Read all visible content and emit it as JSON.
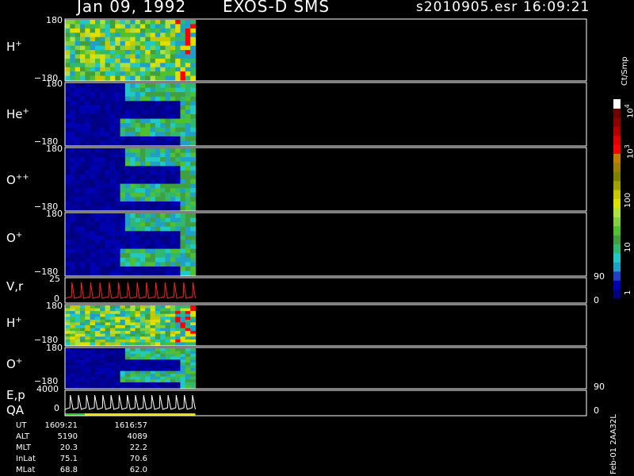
{
  "header": {
    "date": "Jan 09, 1992",
    "instrument": "EXOS-D SMS",
    "file": "s2010905.esr",
    "time": "16:09:21"
  },
  "panels": [
    {
      "label": "H",
      "charge": "+",
      "ymax": "180",
      "ymin": "−180"
    },
    {
      "label": "He",
      "charge": "+",
      "ymax": "180",
      "ymin": "−180"
    },
    {
      "label": "O",
      "charge": "++",
      "ymax": "180",
      "ymin": "−180"
    },
    {
      "label": "O",
      "charge": "+",
      "ymax": "180",
      "ymin": "−180"
    },
    {
      "label": "V,r",
      "charge": "",
      "ymax": "25",
      "ymin": "0",
      "rmax": "90",
      "rmin": "0"
    },
    {
      "label": "H",
      "charge": "+",
      "ymax": "180",
      "ymin": "−180"
    },
    {
      "label": "O",
      "charge": "+",
      "ymax": "180",
      "ymin": "−180"
    },
    {
      "label": "E,p",
      "label2": "QA",
      "charge": "",
      "ymax": "4000",
      "ymin": "0",
      "rmax": "90",
      "rmin": "0"
    }
  ],
  "colorbar": {
    "unit": "Ct/Smp",
    "ticks": [
      "1",
      "10",
      "100",
      "10",
      "10"
    ],
    "exponents": [
      "",
      "",
      "",
      "3",
      "4"
    ],
    "colors": [
      "#000080",
      "#0000b4",
      "#2040c8",
      "#20a0c8",
      "#20c8c8",
      "#30b870",
      "#40a040",
      "#50c030",
      "#80d040",
      "#b0e040",
      "#e0e000",
      "#c8c800",
      "#a0a000",
      "#808000",
      "#a08000",
      "#c08000",
      "#ff0000",
      "#e00000",
      "#b00000",
      "#8b0000",
      "#700000",
      "#ffffff"
    ]
  },
  "footer": {
    "rows": [
      {
        "label": "UT",
        "v1": "1609:21",
        "v2": "1616:57"
      },
      {
        "label": "ALT",
        "v1": "5190",
        "v2": "4089"
      },
      {
        "label": "MLT",
        "v1": "20.3",
        "v2": "22.2"
      },
      {
        "label": "InLat",
        "v1": "75.1",
        "v2": "70.6"
      },
      {
        "label": "MLat",
        "v1": "68.8",
        "v2": "62.0"
      }
    ],
    "side_text": "Feb-01 2AA32L"
  },
  "chart_data": {
    "type": "heatmap",
    "title": "Jan 09, 1992   EXOS-D SMS",
    "x_extent_fraction_of_axis": 0.25,
    "ut_range": [
      "1609:21",
      "1616:57"
    ],
    "panels": [
      {
        "name": "H+",
        "ylim": [
          -180,
          180
        ]
      },
      {
        "name": "He+",
        "ylim": [
          -180,
          180
        ]
      },
      {
        "name": "O++",
        "ylim": [
          -180,
          180
        ]
      },
      {
        "name": "O+",
        "ylim": [
          -180,
          180
        ]
      },
      {
        "name": "V,r",
        "ylim": [
          0,
          25
        ],
        "right_ylim": [
          0,
          90
        ]
      },
      {
        "name": "H+",
        "ylim": [
          -180,
          180
        ]
      },
      {
        "name": "O+",
        "ylim": [
          -180,
          180
        ]
      },
      {
        "name": "E,p / QA",
        "ylim": [
          0,
          4000
        ],
        "right_ylim": [
          0,
          90
        ]
      }
    ],
    "colorbar_scale": "log",
    "colorbar_range": [
      1,
      10000
    ]
  }
}
